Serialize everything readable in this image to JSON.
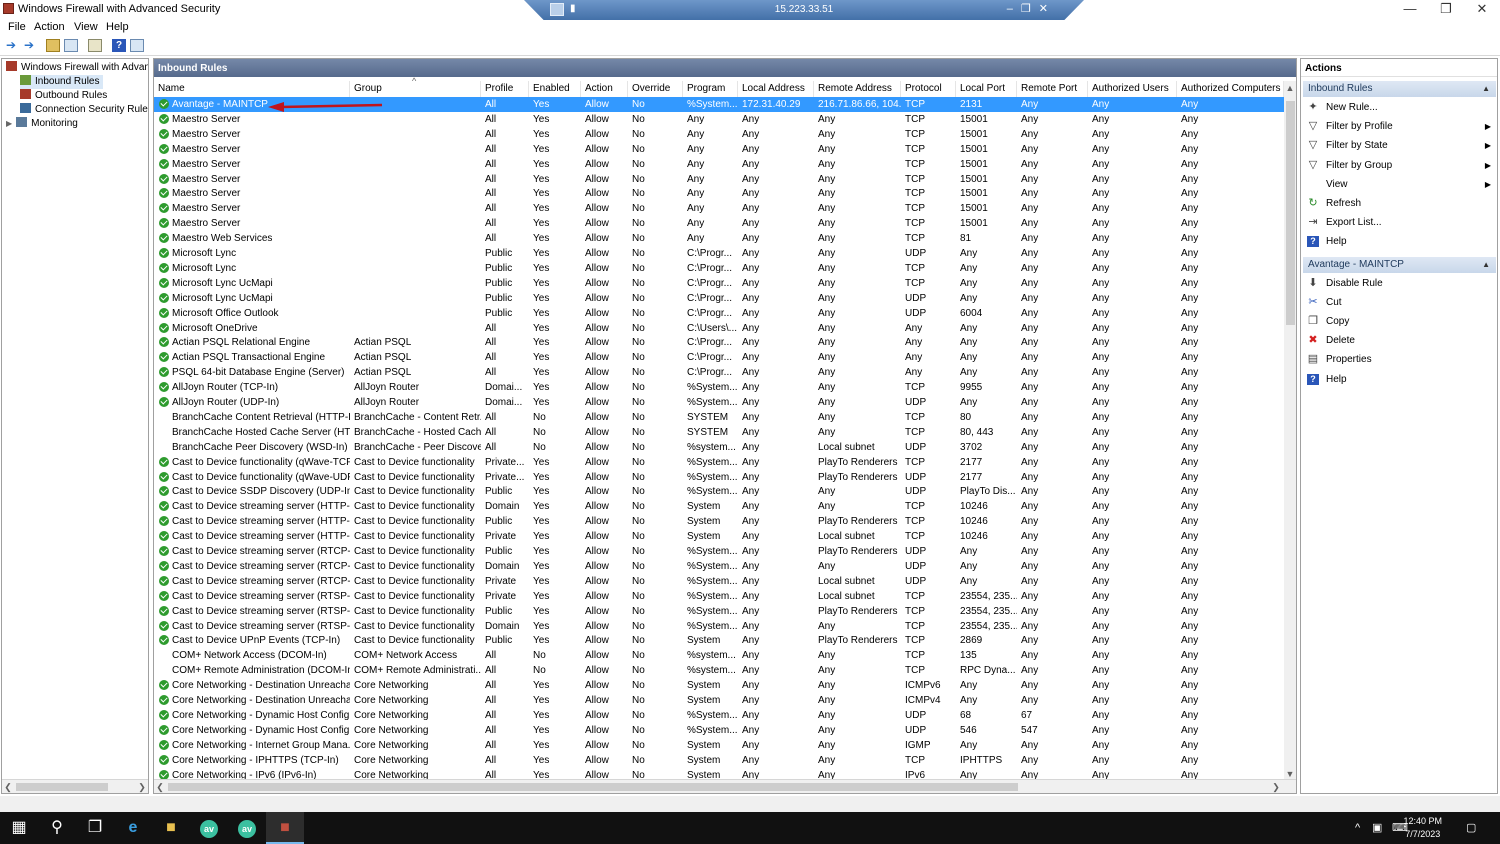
{
  "window": {
    "title": "Windows Firewall with Advanced Security"
  },
  "rdp": {
    "ip": "15.223.33.51"
  },
  "menu": [
    "File",
    "Action",
    "View",
    "Help"
  ],
  "tree": [
    {
      "label": "Windows Firewall with Advanced Security",
      "icon": "firewall-icon"
    },
    {
      "label": "Inbound Rules",
      "icon": "inbound-rules-icon"
    },
    {
      "label": "Outbound Rules",
      "icon": "outbound-rules-icon"
    },
    {
      "label": "Connection Security Rules",
      "icon": "connection-security-icon"
    },
    {
      "label": "Monitoring",
      "icon": "monitoring-icon"
    }
  ],
  "panel": {
    "title": "Inbound Rules"
  },
  "columns": [
    "Name",
    "Group",
    "Profile",
    "Enabled",
    "Action",
    "Override",
    "Program",
    "Local Address",
    "Remote Address",
    "Protocol",
    "Local Port",
    "Remote Port",
    "Authorized Users",
    "Authorized Computers"
  ],
  "rows": [
    [
      "Avantage - MAINTCP",
      "",
      "All",
      "Yes",
      "Allow",
      "No",
      "%System...",
      "172.31.40.29",
      "216.71.86.66, 104....",
      "TCP",
      "2131",
      "Any",
      "Any",
      "Any"
    ],
    [
      "Maestro Server",
      "",
      "All",
      "Yes",
      "Allow",
      "No",
      "Any",
      "Any",
      "Any",
      "TCP",
      "15001",
      "Any",
      "Any",
      "Any"
    ],
    [
      "Maestro Server",
      "",
      "All",
      "Yes",
      "Allow",
      "No",
      "Any",
      "Any",
      "Any",
      "TCP",
      "15001",
      "Any",
      "Any",
      "Any"
    ],
    [
      "Maestro Server",
      "",
      "All",
      "Yes",
      "Allow",
      "No",
      "Any",
      "Any",
      "Any",
      "TCP",
      "15001",
      "Any",
      "Any",
      "Any"
    ],
    [
      "Maestro Server",
      "",
      "All",
      "Yes",
      "Allow",
      "No",
      "Any",
      "Any",
      "Any",
      "TCP",
      "15001",
      "Any",
      "Any",
      "Any"
    ],
    [
      "Maestro Server",
      "",
      "All",
      "Yes",
      "Allow",
      "No",
      "Any",
      "Any",
      "Any",
      "TCP",
      "15001",
      "Any",
      "Any",
      "Any"
    ],
    [
      "Maestro Server",
      "",
      "All",
      "Yes",
      "Allow",
      "No",
      "Any",
      "Any",
      "Any",
      "TCP",
      "15001",
      "Any",
      "Any",
      "Any"
    ],
    [
      "Maestro Server",
      "",
      "All",
      "Yes",
      "Allow",
      "No",
      "Any",
      "Any",
      "Any",
      "TCP",
      "15001",
      "Any",
      "Any",
      "Any"
    ],
    [
      "Maestro Server",
      "",
      "All",
      "Yes",
      "Allow",
      "No",
      "Any",
      "Any",
      "Any",
      "TCP",
      "15001",
      "Any",
      "Any",
      "Any"
    ],
    [
      "Maestro Web Services",
      "",
      "All",
      "Yes",
      "Allow",
      "No",
      "Any",
      "Any",
      "Any",
      "TCP",
      "81",
      "Any",
      "Any",
      "Any"
    ],
    [
      "Microsoft Lync",
      "",
      "Public",
      "Yes",
      "Allow",
      "No",
      "C:\\Progr...",
      "Any",
      "Any",
      "UDP",
      "Any",
      "Any",
      "Any",
      "Any"
    ],
    [
      "Microsoft Lync",
      "",
      "Public",
      "Yes",
      "Allow",
      "No",
      "C:\\Progr...",
      "Any",
      "Any",
      "TCP",
      "Any",
      "Any",
      "Any",
      "Any"
    ],
    [
      "Microsoft Lync UcMapi",
      "",
      "Public",
      "Yes",
      "Allow",
      "No",
      "C:\\Progr...",
      "Any",
      "Any",
      "TCP",
      "Any",
      "Any",
      "Any",
      "Any"
    ],
    [
      "Microsoft Lync UcMapi",
      "",
      "Public",
      "Yes",
      "Allow",
      "No",
      "C:\\Progr...",
      "Any",
      "Any",
      "UDP",
      "Any",
      "Any",
      "Any",
      "Any"
    ],
    [
      "Microsoft Office Outlook",
      "",
      "Public",
      "Yes",
      "Allow",
      "No",
      "C:\\Progr...",
      "Any",
      "Any",
      "UDP",
      "6004",
      "Any",
      "Any",
      "Any"
    ],
    [
      "Microsoft OneDrive",
      "",
      "All",
      "Yes",
      "Allow",
      "No",
      "C:\\Users\\...",
      "Any",
      "Any",
      "Any",
      "Any",
      "Any",
      "Any",
      "Any"
    ],
    [
      "Actian PSQL Relational Engine",
      "Actian PSQL",
      "All",
      "Yes",
      "Allow",
      "No",
      "C:\\Progr...",
      "Any",
      "Any",
      "Any",
      "Any",
      "Any",
      "Any",
      "Any"
    ],
    [
      "Actian PSQL Transactional Engine",
      "Actian PSQL",
      "All",
      "Yes",
      "Allow",
      "No",
      "C:\\Progr...",
      "Any",
      "Any",
      "Any",
      "Any",
      "Any",
      "Any",
      "Any"
    ],
    [
      "PSQL 64-bit Database Engine (Server)",
      "Actian PSQL",
      "All",
      "Yes",
      "Allow",
      "No",
      "C:\\Progr...",
      "Any",
      "Any",
      "Any",
      "Any",
      "Any",
      "Any",
      "Any"
    ],
    [
      "AllJoyn Router (TCP-In)",
      "AllJoyn Router",
      "Domai...",
      "Yes",
      "Allow",
      "No",
      "%System...",
      "Any",
      "Any",
      "TCP",
      "9955",
      "Any",
      "Any",
      "Any"
    ],
    [
      "AllJoyn Router (UDP-In)",
      "AllJoyn Router",
      "Domai...",
      "Yes",
      "Allow",
      "No",
      "%System...",
      "Any",
      "Any",
      "UDP",
      "Any",
      "Any",
      "Any",
      "Any"
    ],
    [
      "BranchCache Content Retrieval (HTTP-In)",
      "BranchCache - Content Retr...",
      "All",
      "No",
      "Allow",
      "No",
      "SYSTEM",
      "Any",
      "Any",
      "TCP",
      "80",
      "Any",
      "Any",
      "Any"
    ],
    [
      "BranchCache Hosted Cache Server (HTT...",
      "BranchCache - Hosted Cach...",
      "All",
      "No",
      "Allow",
      "No",
      "SYSTEM",
      "Any",
      "Any",
      "TCP",
      "80, 443",
      "Any",
      "Any",
      "Any"
    ],
    [
      "BranchCache Peer Discovery (WSD-In)",
      "BranchCache - Peer Discove...",
      "All",
      "No",
      "Allow",
      "No",
      "%system...",
      "Any",
      "Local subnet",
      "UDP",
      "3702",
      "Any",
      "Any",
      "Any"
    ],
    [
      "Cast to Device functionality (qWave-TCP...",
      "Cast to Device functionality",
      "Private...",
      "Yes",
      "Allow",
      "No",
      "%System...",
      "Any",
      "PlayTo Renderers",
      "TCP",
      "2177",
      "Any",
      "Any",
      "Any"
    ],
    [
      "Cast to Device functionality (qWave-UDP...",
      "Cast to Device functionality",
      "Private...",
      "Yes",
      "Allow",
      "No",
      "%System...",
      "Any",
      "PlayTo Renderers",
      "UDP",
      "2177",
      "Any",
      "Any",
      "Any"
    ],
    [
      "Cast to Device SSDP Discovery (UDP-In)",
      "Cast to Device functionality",
      "Public",
      "Yes",
      "Allow",
      "No",
      "%System...",
      "Any",
      "Any",
      "UDP",
      "PlayTo Dis...",
      "Any",
      "Any",
      "Any"
    ],
    [
      "Cast to Device streaming server (HTTP-St...",
      "Cast to Device functionality",
      "Domain",
      "Yes",
      "Allow",
      "No",
      "System",
      "Any",
      "Any",
      "TCP",
      "10246",
      "Any",
      "Any",
      "Any"
    ],
    [
      "Cast to Device streaming server (HTTP-St...",
      "Cast to Device functionality",
      "Public",
      "Yes",
      "Allow",
      "No",
      "System",
      "Any",
      "PlayTo Renderers",
      "TCP",
      "10246",
      "Any",
      "Any",
      "Any"
    ],
    [
      "Cast to Device streaming server (HTTP-St...",
      "Cast to Device functionality",
      "Private",
      "Yes",
      "Allow",
      "No",
      "System",
      "Any",
      "Local subnet",
      "TCP",
      "10246",
      "Any",
      "Any",
      "Any"
    ],
    [
      "Cast to Device streaming server (RTCP-St...",
      "Cast to Device functionality",
      "Public",
      "Yes",
      "Allow",
      "No",
      "%System...",
      "Any",
      "PlayTo Renderers",
      "UDP",
      "Any",
      "Any",
      "Any",
      "Any"
    ],
    [
      "Cast to Device streaming server (RTCP-St...",
      "Cast to Device functionality",
      "Domain",
      "Yes",
      "Allow",
      "No",
      "%System...",
      "Any",
      "Any",
      "UDP",
      "Any",
      "Any",
      "Any",
      "Any"
    ],
    [
      "Cast to Device streaming server (RTCP-St...",
      "Cast to Device functionality",
      "Private",
      "Yes",
      "Allow",
      "No",
      "%System...",
      "Any",
      "Local subnet",
      "UDP",
      "Any",
      "Any",
      "Any",
      "Any"
    ],
    [
      "Cast to Device streaming server (RTSP-Str...",
      "Cast to Device functionality",
      "Private",
      "Yes",
      "Allow",
      "No",
      "%System...",
      "Any",
      "Local subnet",
      "TCP",
      "23554, 235...",
      "Any",
      "Any",
      "Any"
    ],
    [
      "Cast to Device streaming server (RTSP-Str...",
      "Cast to Device functionality",
      "Public",
      "Yes",
      "Allow",
      "No",
      "%System...",
      "Any",
      "PlayTo Renderers",
      "TCP",
      "23554, 235...",
      "Any",
      "Any",
      "Any"
    ],
    [
      "Cast to Device streaming server (RTSP-Str...",
      "Cast to Device functionality",
      "Domain",
      "Yes",
      "Allow",
      "No",
      "%System...",
      "Any",
      "Any",
      "TCP",
      "23554, 235...",
      "Any",
      "Any",
      "Any"
    ],
    [
      "Cast to Device UPnP Events (TCP-In)",
      "Cast to Device functionality",
      "Public",
      "Yes",
      "Allow",
      "No",
      "System",
      "Any",
      "PlayTo Renderers",
      "TCP",
      "2869",
      "Any",
      "Any",
      "Any"
    ],
    [
      "COM+ Network Access (DCOM-In)",
      "COM+ Network Access",
      "All",
      "No",
      "Allow",
      "No",
      "%system...",
      "Any",
      "Any",
      "TCP",
      "135",
      "Any",
      "Any",
      "Any"
    ],
    [
      "COM+ Remote Administration (DCOM-In)",
      "COM+ Remote Administrati...",
      "All",
      "No",
      "Allow",
      "No",
      "%system...",
      "Any",
      "Any",
      "TCP",
      "RPC Dyna...",
      "Any",
      "Any",
      "Any"
    ],
    [
      "Core Networking - Destination Unreacha...",
      "Core Networking",
      "All",
      "Yes",
      "Allow",
      "No",
      "System",
      "Any",
      "Any",
      "ICMPv6",
      "Any",
      "Any",
      "Any",
      "Any"
    ],
    [
      "Core Networking - Destination Unreacha...",
      "Core Networking",
      "All",
      "Yes",
      "Allow",
      "No",
      "System",
      "Any",
      "Any",
      "ICMPv4",
      "Any",
      "Any",
      "Any",
      "Any"
    ],
    [
      "Core Networking - Dynamic Host Config...",
      "Core Networking",
      "All",
      "Yes",
      "Allow",
      "No",
      "%System...",
      "Any",
      "Any",
      "UDP",
      "68",
      "67",
      "Any",
      "Any"
    ],
    [
      "Core Networking - Dynamic Host Config...",
      "Core Networking",
      "All",
      "Yes",
      "Allow",
      "No",
      "%System...",
      "Any",
      "Any",
      "UDP",
      "546",
      "547",
      "Any",
      "Any"
    ],
    [
      "Core Networking - Internet Group Mana...",
      "Core Networking",
      "All",
      "Yes",
      "Allow",
      "No",
      "System",
      "Any",
      "Any",
      "IGMP",
      "Any",
      "Any",
      "Any",
      "Any"
    ],
    [
      "Core Networking - IPHTTPS (TCP-In)",
      "Core Networking",
      "All",
      "Yes",
      "Allow",
      "No",
      "System",
      "Any",
      "Any",
      "TCP",
      "IPHTTPS",
      "Any",
      "Any",
      "Any"
    ],
    [
      "Core Networking - IPv6 (IPv6-In)",
      "Core Networking",
      "All",
      "Yes",
      "Allow",
      "No",
      "System",
      "Any",
      "Any",
      "IPv6",
      "Any",
      "Any",
      "Any",
      "Any"
    ]
  ],
  "actions": {
    "title": "Actions",
    "sections": [
      {
        "title": "Inbound Rules",
        "items": [
          {
            "label": "New Rule...",
            "icon": "new-rule-icon",
            "submenu": false
          },
          {
            "label": "Filter by Profile",
            "icon": "filter-icon",
            "submenu": true
          },
          {
            "label": "Filter by State",
            "icon": "filter-icon",
            "submenu": true
          },
          {
            "label": "Filter by Group",
            "icon": "filter-icon",
            "submenu": true
          },
          {
            "label": "View",
            "icon": "",
            "submenu": true
          },
          {
            "label": "Refresh",
            "icon": "refresh-icon",
            "submenu": false
          },
          {
            "label": "Export List...",
            "icon": "export-icon",
            "submenu": false
          },
          {
            "label": "Help",
            "icon": "help-icon",
            "submenu": false
          }
        ]
      },
      {
        "title": "Avantage - MAINTCP",
        "items": [
          {
            "label": "Disable Rule",
            "icon": "disable-icon",
            "submenu": false
          },
          {
            "label": "Cut",
            "icon": "cut-icon",
            "submenu": false
          },
          {
            "label": "Copy",
            "icon": "copy-icon",
            "submenu": false
          },
          {
            "label": "Delete",
            "icon": "delete-icon",
            "submenu": false
          },
          {
            "label": "Properties",
            "icon": "properties-icon",
            "submenu": false
          },
          {
            "label": "Help",
            "icon": "help-icon",
            "submenu": false
          }
        ]
      }
    ]
  },
  "taskbar": {
    "time": "12:40 PM",
    "date": "7/7/2023",
    "app_badge": "av"
  },
  "colors": {
    "selection": "#3399ff",
    "header": "#566a8c",
    "annotation_arrow": "#c0141c",
    "enabled_check": "#2e9b2e"
  }
}
